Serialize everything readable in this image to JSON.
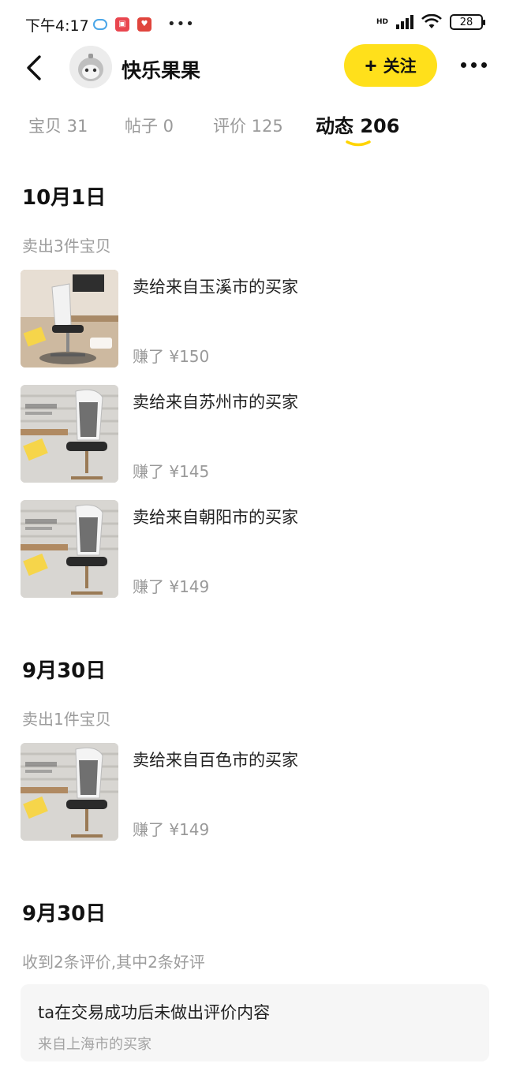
{
  "status_bar": {
    "time": "下午4:17",
    "hd_label": "HD",
    "battery": "28"
  },
  "header": {
    "shop_name": "快乐果果",
    "follow_label": "关注",
    "follow_plus": "+"
  },
  "tabs": [
    {
      "label": "宝贝",
      "count": "31"
    },
    {
      "label": "帖子",
      "count": "0"
    },
    {
      "label": "评价",
      "count": "125"
    },
    {
      "label": "动态",
      "count": "206",
      "active": true
    }
  ],
  "tabs_text": {
    "t0": "宝贝 31",
    "t1": "帖子 0",
    "t2": "评价 125",
    "t3": "动态 206"
  },
  "sections": [
    {
      "date": "10月1日",
      "summary": "卖出3件宝贝",
      "items": [
        {
          "title": "卖给来自玉溪市的买家",
          "earned": "赚了 ¥150"
        },
        {
          "title": "卖给来自苏州市的买家",
          "earned": "赚了 ¥145"
        },
        {
          "title": "卖给来自朝阳市的买家",
          "earned": "赚了 ¥149"
        }
      ]
    },
    {
      "date": "9月30日",
      "summary": "卖出1件宝贝",
      "items": [
        {
          "title": "卖给来自百色市的买家",
          "earned": "赚了 ¥149"
        }
      ]
    },
    {
      "date": "9月30日",
      "summary": "收到2条评价,其中2条好评",
      "review": {
        "text": "ta在交易成功后未做出评价内容",
        "from": "来自上海市的买家"
      }
    }
  ],
  "colors": {
    "accent_yellow": "#ffe01b",
    "muted_text": "#9c9c9c"
  }
}
